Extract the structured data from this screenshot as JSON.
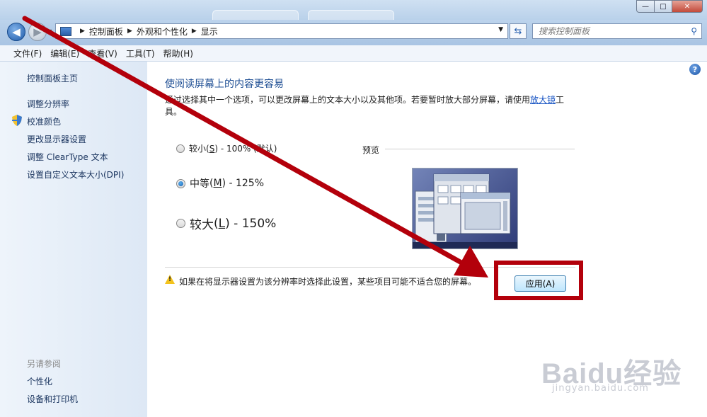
{
  "window": {
    "buttons": {
      "minimize": "—",
      "maximize": "□",
      "close": "✕"
    }
  },
  "nav": {
    "back_glyph": "◀",
    "forward_glyph": "▶",
    "breadcrumb": [
      "控制面板",
      "外观和个性化",
      "显示"
    ],
    "search_placeholder": "搜索控制面板"
  },
  "menu": [
    "文件(F)",
    "编辑(E)",
    "查看(V)",
    "工具(T)",
    "帮助(H)"
  ],
  "sidebar": {
    "links": [
      "控制面板主页",
      "调整分辨率",
      "校准颜色",
      "更改显示器设置",
      "调整 ClearType 文本",
      "设置自定义文本大小(DPI)"
    ],
    "see_also_title": "另请参阅",
    "see_also": [
      "个性化",
      "设备和打印机"
    ]
  },
  "main": {
    "heading": "使阅读屏幕上的内容更容易",
    "desc_before_link": "通过选择其中一个选项，可以更改屏幕上的文本大小以及其他项。若要暂时放大部分屏幕，请使用",
    "desc_link": "放大镜",
    "desc_after_link": "工具。",
    "options": [
      {
        "name": "较小",
        "accel": "S",
        "value": "- 100% (默认)",
        "selected": false
      },
      {
        "name": "中等",
        "accel": "M",
        "value": "- 125%",
        "selected": true
      },
      {
        "name": "较大",
        "accel": "L",
        "value": "- 150%",
        "selected": false
      }
    ],
    "preview_label": "预览",
    "warning": "如果在将显示器设置为该分辨率时选择此设置，某些项目可能不适合您的屏幕。",
    "apply_label": "应用(A)"
  },
  "annotation": {
    "color": "#b3000b"
  },
  "watermark": {
    "logo": "Baidu经验",
    "url": "jingyan.baidu.com"
  }
}
